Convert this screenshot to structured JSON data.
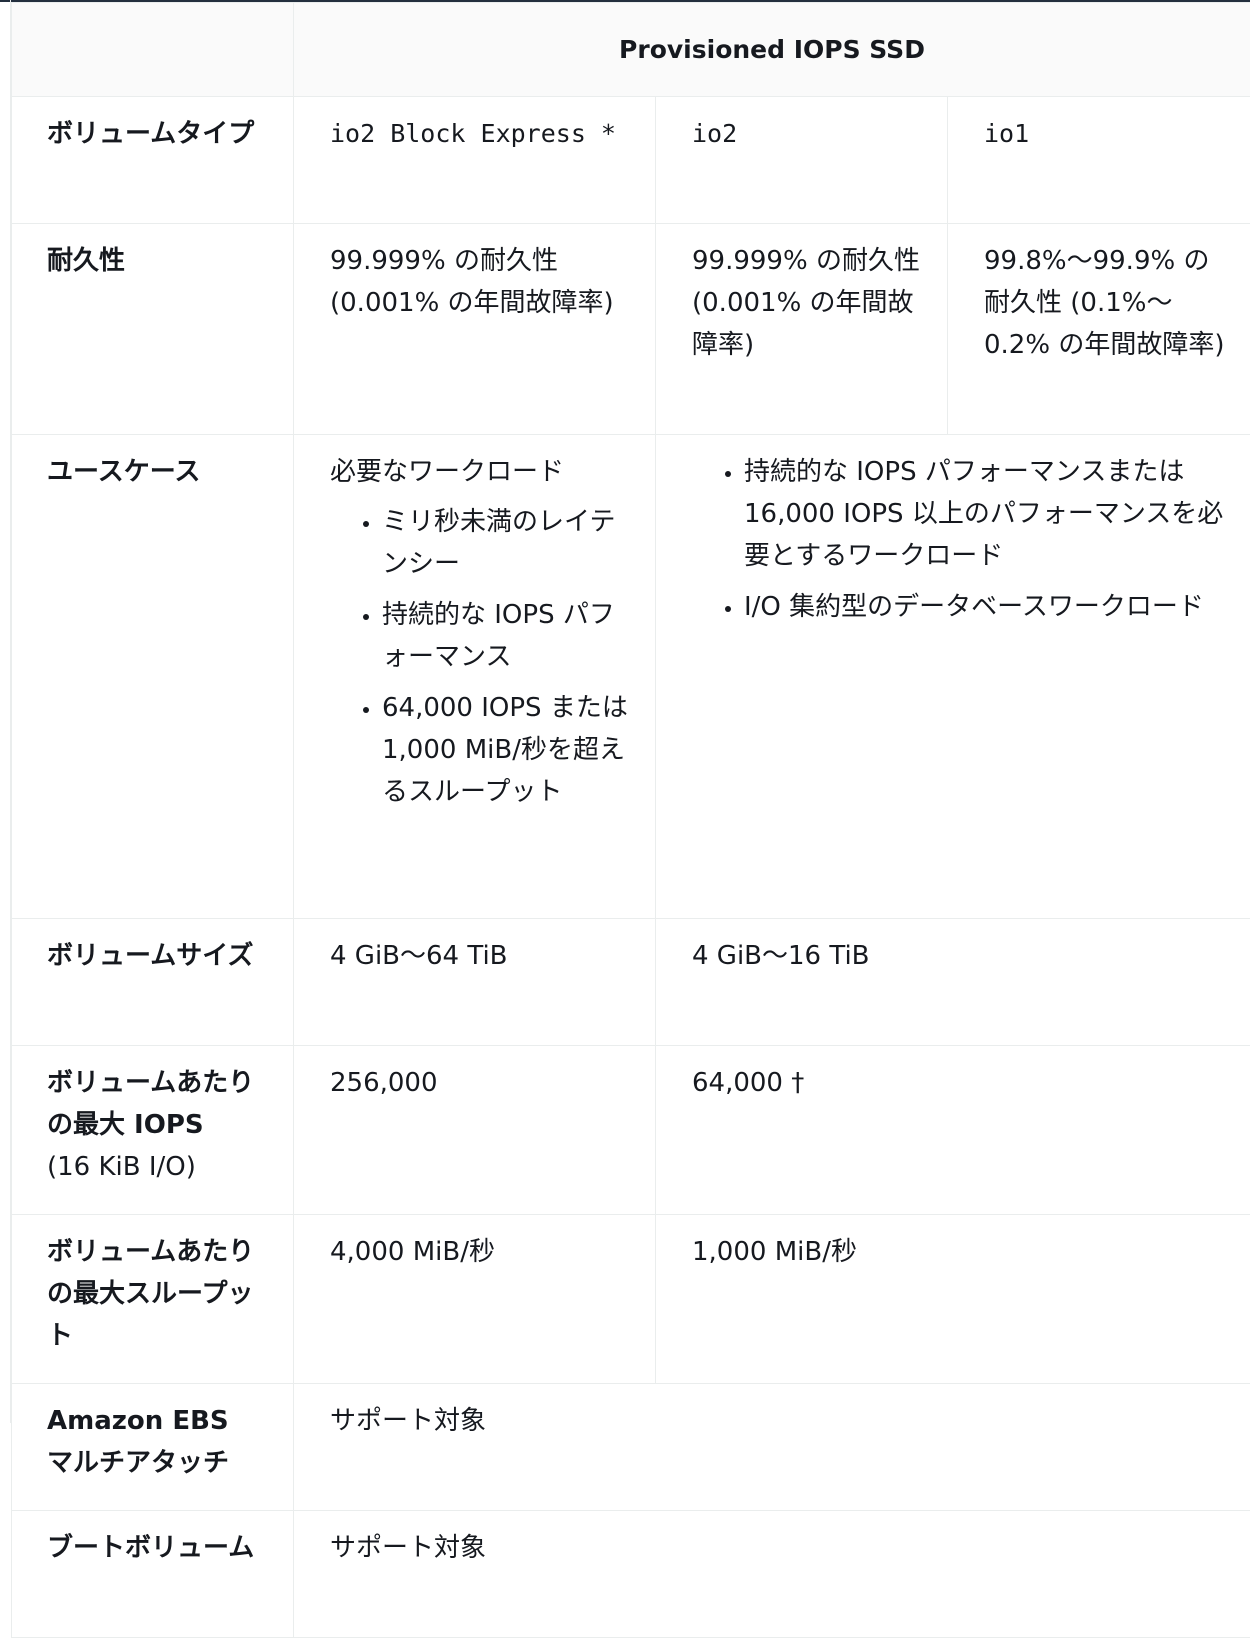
{
  "table": {
    "group_header": "Provisioned IOPS SSD",
    "rows": {
      "volume_type": {
        "label": "ボリュームタイプ",
        "io2_block_express": "io2 Block Express *",
        "io2": "io2",
        "io1": "io1"
      },
      "durability": {
        "label": "耐久性",
        "io2_block_express": "99.999% の耐久性 (0.001% の年間故障率)",
        "io2": "99.999% の耐久性 (0.001% の年間故障率)",
        "io1": "99.8%～99.9% の耐久性 (0.1%～0.2% の年間故障率)"
      },
      "use_cases": {
        "label": "ユースケース",
        "io2_block_express": {
          "lead": "必要なワークロード",
          "items": [
            "ミリ秒未満のレイテンシー",
            "持続的な IOPS パフォーマンス",
            "64,000 IOPS または 1,000 MiB/秒を超えるスループット"
          ]
        },
        "io2_io1": {
          "items": [
            "持続的な IOPS パフォーマンスまたは 16,000 IOPS 以上のパフォーマンスを必要とするワークロード",
            "I/O 集約型のデータベースワークロード"
          ]
        }
      },
      "volume_size": {
        "label": "ボリュームサイズ",
        "io2_block_express": "4 GiB～64 TiB",
        "io2_io1": "4 GiB～16 TiB"
      },
      "max_iops": {
        "label": "ボリュームあたりの最大 IOPS",
        "label_sub": "(16 KiB I/O)",
        "io2_block_express": "256,000",
        "io2_io1": "64,000 †"
      },
      "max_throughput": {
        "label": "ボリュームあたりの最大スループット",
        "io2_block_express": "4,000 MiB/秒",
        "io2_io1": "1,000 MiB/秒"
      },
      "multi_attach": {
        "label": "Amazon EBS マルチアタッチ",
        "value": "サポート対象"
      },
      "boot_volume": {
        "label": "ブートボリューム",
        "value": "サポート対象"
      }
    }
  }
}
